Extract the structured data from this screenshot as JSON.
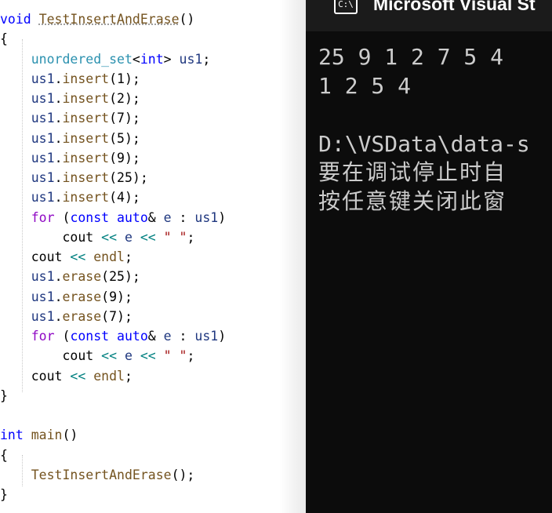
{
  "editor": {
    "lines": [
      {
        "p": [
          [
            "kw",
            "void"
          ],
          [
            "pl",
            " "
          ],
          [
            "fn",
            "TestInsertAndErase"
          ],
          [
            "pl",
            "()"
          ]
        ]
      },
      {
        "p": [
          [
            "pl",
            "{"
          ]
        ]
      },
      {
        "p": [
          [
            "pl",
            "    "
          ],
          [
            "ty",
            "unordered_set"
          ],
          [
            "pl",
            "<"
          ],
          [
            "kw",
            "int"
          ],
          [
            "pl",
            "> "
          ],
          [
            "var",
            "us1"
          ],
          [
            "pl",
            ";"
          ]
        ]
      },
      {
        "p": [
          [
            "pl",
            "    "
          ],
          [
            "var",
            "us1"
          ],
          [
            "pl",
            "."
          ],
          [
            "fn",
            "insert"
          ],
          [
            "pl",
            "(1);"
          ]
        ]
      },
      {
        "p": [
          [
            "pl",
            "    "
          ],
          [
            "var",
            "us1"
          ],
          [
            "pl",
            "."
          ],
          [
            "fn",
            "insert"
          ],
          [
            "pl",
            "(2);"
          ]
        ]
      },
      {
        "p": [
          [
            "pl",
            "    "
          ],
          [
            "var",
            "us1"
          ],
          [
            "pl",
            "."
          ],
          [
            "fn",
            "insert"
          ],
          [
            "pl",
            "(7);"
          ]
        ]
      },
      {
        "p": [
          [
            "pl",
            "    "
          ],
          [
            "var",
            "us1"
          ],
          [
            "pl",
            "."
          ],
          [
            "fn",
            "insert"
          ],
          [
            "pl",
            "(5);"
          ]
        ]
      },
      {
        "p": [
          [
            "pl",
            "    "
          ],
          [
            "var",
            "us1"
          ],
          [
            "pl",
            "."
          ],
          [
            "fn",
            "insert"
          ],
          [
            "pl",
            "(9);"
          ]
        ]
      },
      {
        "p": [
          [
            "pl",
            "    "
          ],
          [
            "var",
            "us1"
          ],
          [
            "pl",
            "."
          ],
          [
            "fn",
            "insert"
          ],
          [
            "pl",
            "(25);"
          ]
        ]
      },
      {
        "p": [
          [
            "pl",
            "    "
          ],
          [
            "var",
            "us1"
          ],
          [
            "pl",
            "."
          ],
          [
            "fn",
            "insert"
          ],
          [
            "pl",
            "(4);"
          ]
        ]
      },
      {
        "p": [
          [
            "pl",
            "    "
          ],
          [
            "kwp",
            "for"
          ],
          [
            "pl",
            " ("
          ],
          [
            "kw",
            "const"
          ],
          [
            "pl",
            " "
          ],
          [
            "kw",
            "auto"
          ],
          [
            "pl",
            "& "
          ],
          [
            "var",
            "e"
          ],
          [
            "pl",
            " : "
          ],
          [
            "var",
            "us1"
          ],
          [
            "pl",
            ")"
          ]
        ]
      },
      {
        "p": [
          [
            "pl",
            "        cout "
          ],
          [
            "op",
            "<<"
          ],
          [
            "pl",
            " "
          ],
          [
            "var",
            "e"
          ],
          [
            "pl",
            " "
          ],
          [
            "op",
            "<<"
          ],
          [
            "pl",
            " "
          ],
          [
            "str",
            "\" \""
          ],
          [
            "pl",
            ";"
          ]
        ]
      },
      {
        "p": [
          [
            "pl",
            "    cout "
          ],
          [
            "op",
            "<<"
          ],
          [
            "pl",
            " "
          ],
          [
            "fn",
            "endl"
          ],
          [
            "pl",
            ";"
          ]
        ]
      },
      {
        "p": [
          [
            "pl",
            "    "
          ],
          [
            "var",
            "us1"
          ],
          [
            "pl",
            "."
          ],
          [
            "fn",
            "erase"
          ],
          [
            "pl",
            "(25);"
          ]
        ]
      },
      {
        "p": [
          [
            "pl",
            "    "
          ],
          [
            "var",
            "us1"
          ],
          [
            "pl",
            "."
          ],
          [
            "fn",
            "erase"
          ],
          [
            "pl",
            "(9);"
          ]
        ]
      },
      {
        "p": [
          [
            "pl",
            "    "
          ],
          [
            "var",
            "us1"
          ],
          [
            "pl",
            "."
          ],
          [
            "fn",
            "erase"
          ],
          [
            "pl",
            "(7);"
          ]
        ]
      },
      {
        "p": [
          [
            "pl",
            "    "
          ],
          [
            "kwp",
            "for"
          ],
          [
            "pl",
            " ("
          ],
          [
            "kw",
            "const"
          ],
          [
            "pl",
            " "
          ],
          [
            "kw",
            "auto"
          ],
          [
            "pl",
            "& "
          ],
          [
            "var",
            "e"
          ],
          [
            "pl",
            " : "
          ],
          [
            "var",
            "us1"
          ],
          [
            "pl",
            ")"
          ]
        ]
      },
      {
        "p": [
          [
            "pl",
            "        cout "
          ],
          [
            "op",
            "<<"
          ],
          [
            "pl",
            " "
          ],
          [
            "var",
            "e"
          ],
          [
            "pl",
            " "
          ],
          [
            "op",
            "<<"
          ],
          [
            "pl",
            " "
          ],
          [
            "str",
            "\" \""
          ],
          [
            "pl",
            ";"
          ]
        ]
      },
      {
        "p": [
          [
            "pl",
            "    cout "
          ],
          [
            "op",
            "<<"
          ],
          [
            "pl",
            " "
          ],
          [
            "fn",
            "endl"
          ],
          [
            "pl",
            ";"
          ]
        ]
      },
      {
        "p": [
          [
            "pl",
            "}"
          ]
        ]
      },
      {
        "p": [
          [
            "pl",
            ""
          ]
        ]
      },
      {
        "p": [
          [
            "kw",
            "int"
          ],
          [
            "pl",
            " "
          ],
          [
            "fn",
            "main"
          ],
          [
            "pl",
            "()"
          ]
        ]
      },
      {
        "p": [
          [
            "pl",
            "{"
          ]
        ]
      },
      {
        "p": [
          [
            "pl",
            "    "
          ],
          [
            "fn",
            "TestInsertAndErase"
          ],
          [
            "pl",
            "();"
          ]
        ]
      },
      {
        "p": [
          [
            "pl",
            "}"
          ]
        ]
      }
    ]
  },
  "console": {
    "title": "Microsoft Visual St",
    "icon": "C:\\",
    "output_line1": "25 9 1 2 7 5 4",
    "output_line2": "1 2 5 4",
    "path_line": "D:\\VSData\\data-s",
    "msg_line1": "要在调试停止时自",
    "msg_line2": "按任意键关闭此窗"
  },
  "colors": {
    "keyword": "#0000ff",
    "type": "#2b91af",
    "variable": "#1f377f",
    "function": "#74531f",
    "string": "#a31515",
    "control": "#8f08c4",
    "operator": "#008080",
    "console_bg": "#0c0c0c",
    "console_text": "#cccccc"
  }
}
